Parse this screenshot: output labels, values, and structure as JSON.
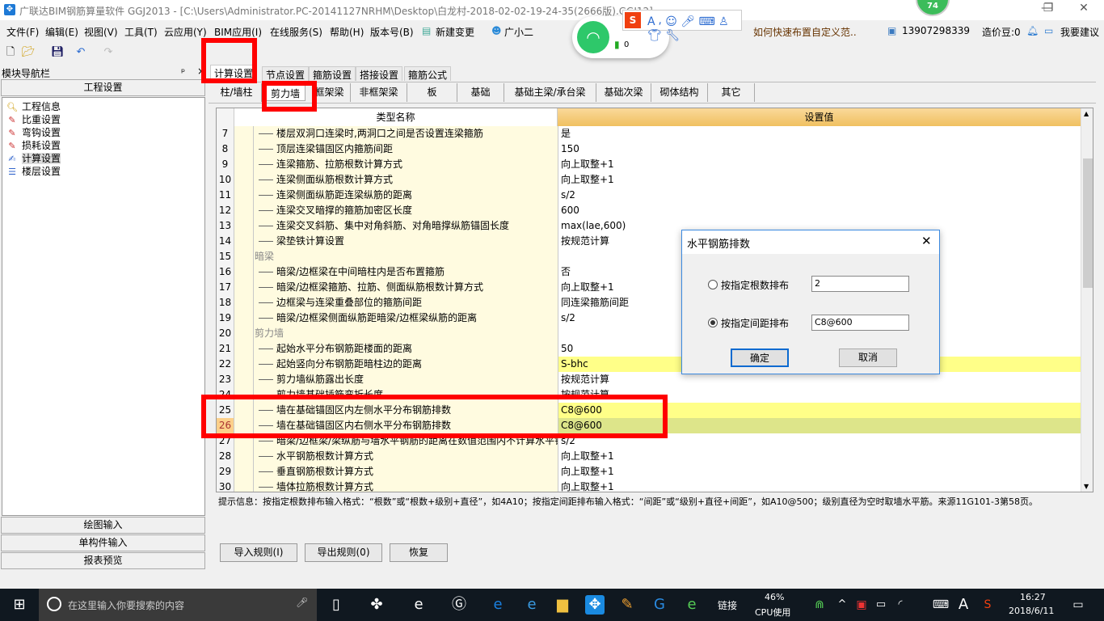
{
  "window": {
    "title": "广联达BIM钢筋算量软件 GGJ2013 - [C:\\Users\\Administrator.PC-20141127NRHM\\Desktop\\白龙村-2018-02-02-19-24-35(2666版).GGJ12]",
    "min": "—",
    "max": "❐",
    "close": "✕"
  },
  "menu": {
    "items": [
      "文件(F)",
      "编辑(E)",
      "视图(V)",
      "工具(T)",
      "云应用(Y)",
      "BIM应用(I)",
      "在线服务(S)",
      "帮助(H)",
      "版本号(B)",
      "新建变更",
      "广小二"
    ],
    "news": "如何快速布置自定义范..",
    "account": "13907298339",
    "beans": "造价豆:0",
    "suggest": "我要建议"
  },
  "overlay": {
    "badge": "74",
    "wifi_count": "0"
  },
  "nav": {
    "title": "模块导航栏",
    "pin": "ᵖ",
    "close": "×",
    "section": "工程设置",
    "items": [
      "工程信息",
      "比重设置",
      "弯钩设置",
      "损耗设置",
      "计算设置",
      "楼层设置"
    ],
    "bottom": [
      "绘图输入",
      "单构件输入",
      "报表预览"
    ]
  },
  "tabs": [
    "计算设置",
    "节点设置",
    "箍筋设置",
    "搭接设置",
    "箍筋公式"
  ],
  "subtabs": [
    "柱/墙柱",
    "剪力墙",
    "框架梁",
    "非框架梁",
    "板",
    "基础",
    "基础主梁/承台梁",
    "基础次梁",
    "砌体结构",
    "其它"
  ],
  "grid": {
    "col_name": "类型名称",
    "col_value": "设置值",
    "rows": [
      {
        "n": "7",
        "name": "楼层双洞口连梁时,两洞口之间是否设置连梁箍筋",
        "value": "是"
      },
      {
        "n": "8",
        "name": "顶层连梁锚固区内箍筋间距",
        "value": "150"
      },
      {
        "n": "9",
        "name": "连梁箍筋、拉筋根数计算方式",
        "value": "向上取整+1"
      },
      {
        "n": "10",
        "name": "连梁侧面纵筋根数计算方式",
        "value": "向上取整+1"
      },
      {
        "n": "11",
        "name": "连梁侧面纵筋距连梁纵筋的距离",
        "value": "s/2"
      },
      {
        "n": "12",
        "name": "连梁交叉暗撑的箍筋加密区长度",
        "value": "600"
      },
      {
        "n": "13",
        "name": "连梁交叉斜筋、集中对角斜筋、对角暗撑纵筋锚固长度",
        "value": "max(lae,600)"
      },
      {
        "n": "14",
        "name": "梁垫铁计算设置",
        "value": "按规范计算"
      },
      {
        "n": "15",
        "name": "暗梁",
        "value": "",
        "group": true
      },
      {
        "n": "16",
        "name": "暗梁/边框梁在中间暗柱内是否布置箍筋",
        "value": "否"
      },
      {
        "n": "17",
        "name": "暗梁/边框梁箍筋、拉筋、侧面纵筋根数计算方式",
        "value": "向上取整+1"
      },
      {
        "n": "18",
        "name": "边框梁与连梁重叠部位的箍筋间距",
        "value": "同连梁箍筋间距"
      },
      {
        "n": "19",
        "name": "暗梁/边框梁侧面纵筋距暗梁/边框梁纵筋的距离",
        "value": "s/2"
      },
      {
        "n": "20",
        "name": "剪力墙",
        "value": "",
        "group": true
      },
      {
        "n": "21",
        "name": "起始水平分布钢筋距楼面的距离",
        "value": "50"
      },
      {
        "n": "22",
        "name": "起始竖向分布钢筋距暗柱边的距离",
        "value": "S-bhc",
        "hl": "#ffff88"
      },
      {
        "n": "23",
        "name": "剪力墙纵筋露出长度",
        "value": "按规范计算"
      },
      {
        "n": "24",
        "name": "剪力墙基础插筋弯折长度",
        "value": "按规范计算"
      },
      {
        "n": "25",
        "name": "墙在基础锚固区内左侧水平分布钢筋排数",
        "value": "C8@600",
        "hl": "#ffff88"
      },
      {
        "n": "26",
        "name": "墙在基础锚固区内右侧水平分布钢筋排数",
        "value": "C8@600",
        "hl": "#dde58a",
        "sel": true
      },
      {
        "n": "27",
        "name": "暗梁/边框梁/梁纵筋与墙水平钢筋的距离在数值范围内不计算水平钢",
        "value": "s/2"
      },
      {
        "n": "28",
        "name": "水平钢筋根数计算方式",
        "value": "向上取整+1"
      },
      {
        "n": "29",
        "name": "垂直钢筋根数计算方式",
        "value": "向上取整+1"
      },
      {
        "n": "30",
        "name": "墙体拉筋根数计算方式",
        "value": "向上取整+1"
      }
    ]
  },
  "hint": "提示信息：按指定根数排布输入格式：“根数”或“根数+级别+直径”，如4A10；按指定间距排布输入格式：“间距”或“级别+直径+间距”，如A10@500；级别直径为空时取墙水平筋。来源11G101-3第58页。",
  "buttons": {
    "import": "导入规则(I)",
    "export": "导出规则(0)",
    "restore": "恢复"
  },
  "dialog": {
    "title": "水平钢筋排数",
    "opt1": "按指定根数排布",
    "val1": "2",
    "opt2": "按指定间距排布",
    "val2": "C8@600",
    "selected": "opt2",
    "ok": "确定",
    "cancel": "取消"
  },
  "taskbar": {
    "search": "在这里输入你要搜索的内容",
    "link": "链接",
    "cpu": "46%",
    "cpu_label": "CPU使用",
    "time": "16:27",
    "date": "2018/6/11",
    "ime": "A"
  }
}
